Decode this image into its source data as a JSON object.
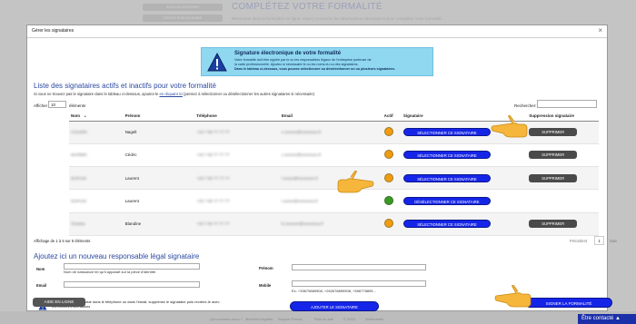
{
  "background": {
    "btn1": "SUIVI DU DOSSIER",
    "btn2": "CREER SON DOSSIER",
    "title": "COMPLÉTEZ VOTRE FORMALITÉ",
    "text": "Bienvenue dans le formulaire en ligne. Vous y trouverez les informations nécessaires pour compléter votre formalité...",
    "footer": [
      "Qui sommes-nous ?",
      "Mentions légales",
      "Espace Presse",
      "Plan du site",
      "© 2024",
      "Webmaster"
    ]
  },
  "modal": {
    "title": "Gérer les signataires",
    "close_label": "×"
  },
  "info": {
    "title": "Signature électronique de votre formalité",
    "line1": "Votre formalité doit être signée par le ou les responsables légaux de l'entreprise porteuse de",
    "line2": "la carte professionnelle. Ajoutez si nécessaire le ou les noms du ou des signataires.",
    "line3": "Dans le tableau ci-dessous, vous pouvez sélectionner ou désélectionner un ou plusieurs signataires."
  },
  "list": {
    "heading": "Liste des signataires actifs et inactifs pour votre formalité",
    "help_prefix": "Si vous ne trouvez pas le signataire dans le tableau ci-dessous, ajoutez-le ",
    "help_link": "en cliquant ici",
    "help_suffix": " (pensez à sélectionner ou désélectionner les autres signataires si nécessaire)",
    "show_label": "Afficher",
    "show_value": "10",
    "show_suffix": "éléments",
    "search_label": "Rechercher:"
  },
  "table": {
    "headers": {
      "nom": "Nom",
      "prenom": "Prénom",
      "tel": "Téléphone",
      "email": "Email",
      "actif": "Actif",
      "sig": "Signataire",
      "sup": "Suppression signataire"
    },
    "rows": [
      {
        "nom": "COUDRI",
        "prenom": "Nagell",
        "tel": "+33 7 80 77 77 77",
        "email": "x.xxxxxx@xxxxxxxx.fr",
        "status": "orange",
        "sig": "SÉLECTIONNER CE SIGNATAIRE",
        "sup": "SUPPRIMER"
      },
      {
        "nom": "MARBIN",
        "prenom": "Cédric",
        "tel": "+33 7 80 77 77 77",
        "email": "c.xxxxxx@xxxxxxxx.fr",
        "status": "orange",
        "sig": "SÉLECTIONNER CE SIGNATAIRE",
        "sup": "SUPPRIMER"
      },
      {
        "nom": "DUPUIS",
        "prenom": "Laurent",
        "tel": "+33 7 80 77 77 77",
        "email": "l.xxxxx@xxxxxxxx.fr",
        "status": "orange",
        "sig": "SÉLECTIONNER CE SIGNATAIRE",
        "sup": "SUPPRIMER"
      },
      {
        "nom": "DUPUIS",
        "prenom": "Laurent",
        "tel": "+33 7 80 77 77 77",
        "email": "l.xxxxx@xxxxxxxx.fr",
        "status": "green",
        "sig": "DÉSÉLECTIONNER CE SIGNATAIRE",
        "sup": ""
      },
      {
        "nom": "Tertaise",
        "prenom": "Blandine",
        "tel": "+33 7 80 77 77 77",
        "email": "b.xxxxxxx@xxxxxxxx.fr",
        "status": "orange",
        "sig": "SÉLECTIONNER CE SIGNATAIRE",
        "sup": "SUPPRIMER"
      }
    ],
    "info": "Affichage de 1 à 5 sur 5 éléments",
    "prev": "Précédent",
    "page": "1",
    "next": "Suiv"
  },
  "add": {
    "heading": "Ajoutez ici un nouveau responsable légal signataire",
    "nom_label": "Nom",
    "nom_hint": "Nom de naissance tel qu'il apparaît sur la pièce d'identité.",
    "prenom_label": "Prénom",
    "email_label": "Email",
    "mobile_label": "Mobile",
    "mobile_hint": "Ex: +33679889908, +262678899908, +596778899...",
    "warn_text": "En cas d'erreur de saisie dans le téléphone ou dans l'email, supprimez le signataire puis recréez-le avec les bonnes informations",
    "add_button": "AJOUTER LE SIGNATAIRE"
  },
  "footer_buttons": {
    "help": "AIDE EN LIGNE",
    "sign": "SIGNER LA FORMALITÉ"
  },
  "contact": {
    "label": "Être contacté ▲"
  },
  "colors": {
    "primary_blue": "#1525e8",
    "heading_blue": "#2c4aa0",
    "status_orange": "#f29b0e",
    "status_green": "#3a9b24",
    "info_bg": "#8fd8f0",
    "hand": "#f6b63b"
  }
}
